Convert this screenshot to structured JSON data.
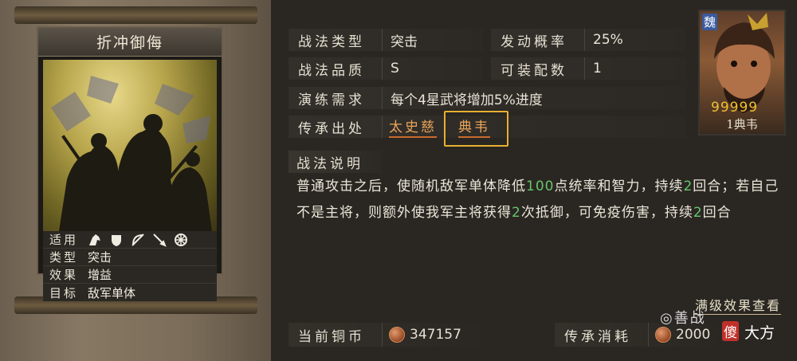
{
  "card": {
    "title": "折冲御侮",
    "stats": [
      {
        "key": "适用",
        "value": ""
      },
      {
        "key": "类型",
        "value": "突击"
      },
      {
        "key": "效果",
        "value": "增益"
      },
      {
        "key": "目标",
        "value": "敌军单体"
      }
    ],
    "unit_icons": [
      "cavalry-icon",
      "shield-icon",
      "bow-icon",
      "spear-icon",
      "siege-wheel-icon"
    ]
  },
  "info": {
    "type_label": "战法类型",
    "type_value": "突击",
    "trigger_label": "发动概率",
    "trigger_value": "25%",
    "quality_label": "战法品质",
    "quality_value": "S",
    "slots_label": "可装配数",
    "slots_value": "1",
    "practice_label": "演练需求",
    "practice_value": "每个4星武将增加5%进度",
    "source_label": "传承出处",
    "sources": [
      "太史慈",
      "典韦"
    ]
  },
  "description": {
    "title": "战法说明",
    "parts": [
      "普通攻击之后，使随机敌军单体降低",
      "100",
      "点统率和智力，持续",
      "2",
      "回合；若自己不是主将，则额外使我军主将获得",
      "2",
      "次抵御，可免疫伤害，持续",
      "2",
      "回合"
    ]
  },
  "full_effect_link": "满级效果查看",
  "bottom": {
    "coins_label": "当前铜币",
    "coins_value": "347157",
    "cost_label": "传承消耗",
    "cost_value": "2000"
  },
  "portrait": {
    "faction": "魏",
    "stars": "99999",
    "name": "1典韦"
  },
  "watermark": {
    "text1": "善战",
    "badge": "傻",
    "text2": "大方"
  },
  "colors": {
    "highlight_box": "#e8b030",
    "green_value": "#66c46a",
    "source_text": "#e9a55a"
  }
}
